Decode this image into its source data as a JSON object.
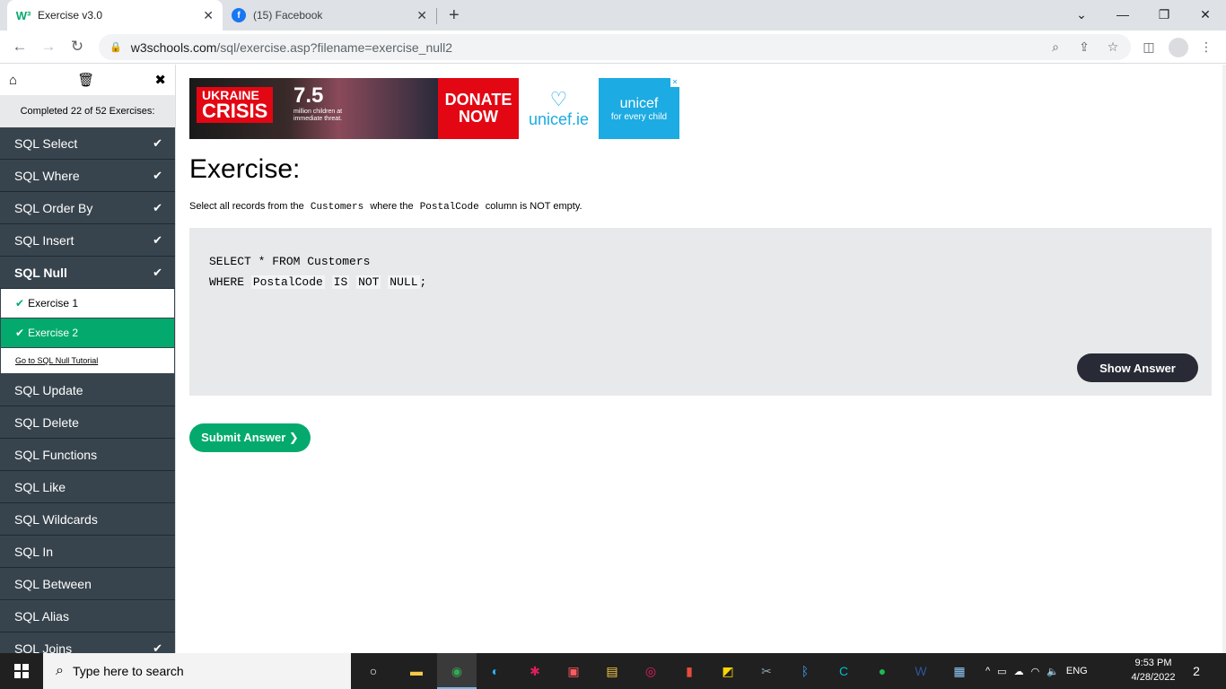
{
  "browser": {
    "tabs": [
      {
        "title": "Exercise v3.0",
        "active": true
      },
      {
        "title": "(15) Facebook",
        "active": false
      }
    ],
    "url_host": "w3schools.com",
    "url_path": "/sql/exercise.asp?filename=exercise_null2"
  },
  "sidebar": {
    "completed": "Completed 22 of 52 Exercises:",
    "items_before": [
      {
        "label": "SQL Select"
      },
      {
        "label": "SQL Where"
      },
      {
        "label": "SQL Order By"
      },
      {
        "label": "SQL Insert"
      },
      {
        "label": "SQL Null"
      }
    ],
    "sub_items": [
      {
        "label": "Exercise 1"
      },
      {
        "label": "Exercise 2"
      }
    ],
    "tutorial_link": "Go to SQL Null Tutorial",
    "items_after": [
      {
        "label": "SQL Update"
      },
      {
        "label": "SQL Delete"
      },
      {
        "label": "SQL Functions"
      },
      {
        "label": "SQL Like"
      },
      {
        "label": "SQL Wildcards"
      },
      {
        "label": "SQL In"
      },
      {
        "label": "SQL Between"
      },
      {
        "label": "SQL Alias"
      },
      {
        "label": "SQL Joins"
      }
    ]
  },
  "ad": {
    "ukraine": "UKRAINE",
    "crisis": "CRISIS",
    "number": "7.5",
    "sub": "million children at immediate threat.",
    "donate_1": "DONATE",
    "donate_2": "NOW",
    "site": "unicef.ie",
    "brand": "unicef",
    "tagline": "for every child"
  },
  "main": {
    "heading": "Exercise:",
    "instr_1": "Select all records from the",
    "instr_table": "Customers",
    "instr_2": "where the",
    "instr_column": "PostalCode",
    "instr_3": "column is NOT empty.",
    "code_line1": "SELECT * FROM Customers",
    "code_where": "WHERE",
    "code_col": "PostalCode",
    "code_is": "IS",
    "code_not": "NOT",
    "code_null": "NULL",
    "code_end": ";",
    "show_answer": "Show Answer",
    "submit": "Submit Answer ❯"
  },
  "taskbar": {
    "search_placeholder": "Type here to search",
    "language": "ENG",
    "time": "9:53 PM",
    "date": "4/28/2022",
    "notifications": "2"
  }
}
